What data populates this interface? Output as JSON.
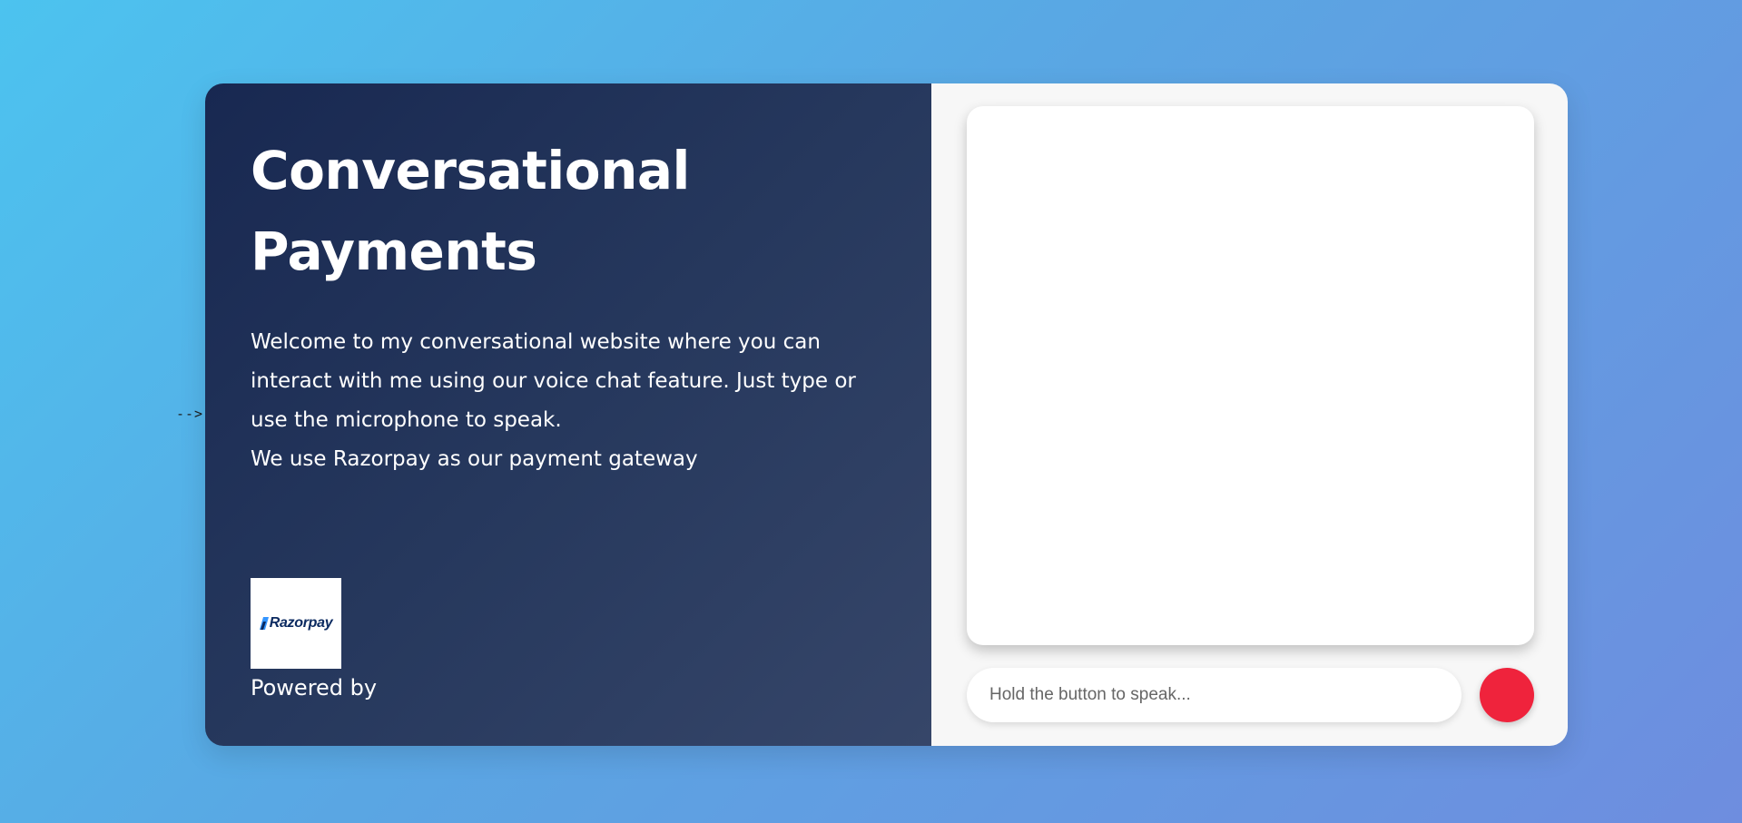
{
  "stray_text": "-->",
  "hero": {
    "title_line1": "Conversational",
    "title_line2": "Payments",
    "description": "Welcome to my conversational website where you can interact with me using our voice chat feature. Just type or use the microphone to speak.",
    "gateway_note": "We use Razorpay as our payment gateway"
  },
  "brand": {
    "logo_text": "Razorpay",
    "logo_icon": "razorpay-logo-icon",
    "powered_label": "Powered by"
  },
  "chat": {
    "input_placeholder": "Hold the button to speak...",
    "input_value": "",
    "mic_button_icon": "record-button-icon"
  },
  "colors": {
    "background_start": "#4cc3ef",
    "background_end": "#6e8ddf",
    "left_panel": "#1e2f56",
    "mic_button": "#ef233c",
    "logo_text": "#0b2a60"
  }
}
